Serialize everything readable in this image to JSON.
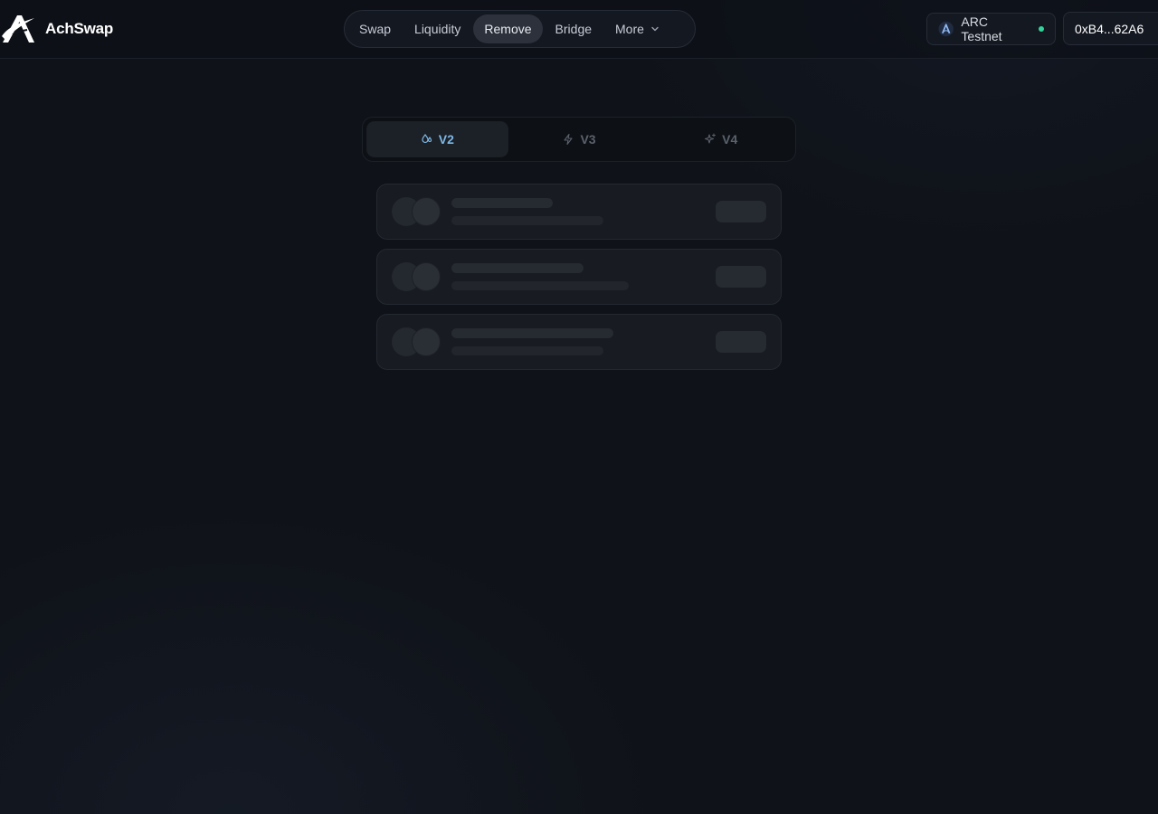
{
  "brand": {
    "name": "AchSwap",
    "logo_icon": "achswap-logo-icon"
  },
  "nav": {
    "items": [
      {
        "label": "Swap",
        "active": false
      },
      {
        "label": "Liquidity",
        "active": false
      },
      {
        "label": "Remove",
        "active": true
      },
      {
        "label": "Bridge",
        "active": false
      },
      {
        "label": "More",
        "active": false,
        "icon": "chevron-down-icon"
      }
    ]
  },
  "network": {
    "label": "ARC Testnet",
    "icon": "arc-network-icon",
    "status_color": "#34d399"
  },
  "wallet": {
    "address": "0xB4...62A6"
  },
  "version_tabs": [
    {
      "label": "V2",
      "icon": "droplets-icon",
      "active": true
    },
    {
      "label": "V3",
      "icon": "zap-icon",
      "active": false
    },
    {
      "label": "V4",
      "icon": "sparkles-icon",
      "active": false
    }
  ],
  "accent_color": "#7db8e6",
  "loading_cards": 3
}
